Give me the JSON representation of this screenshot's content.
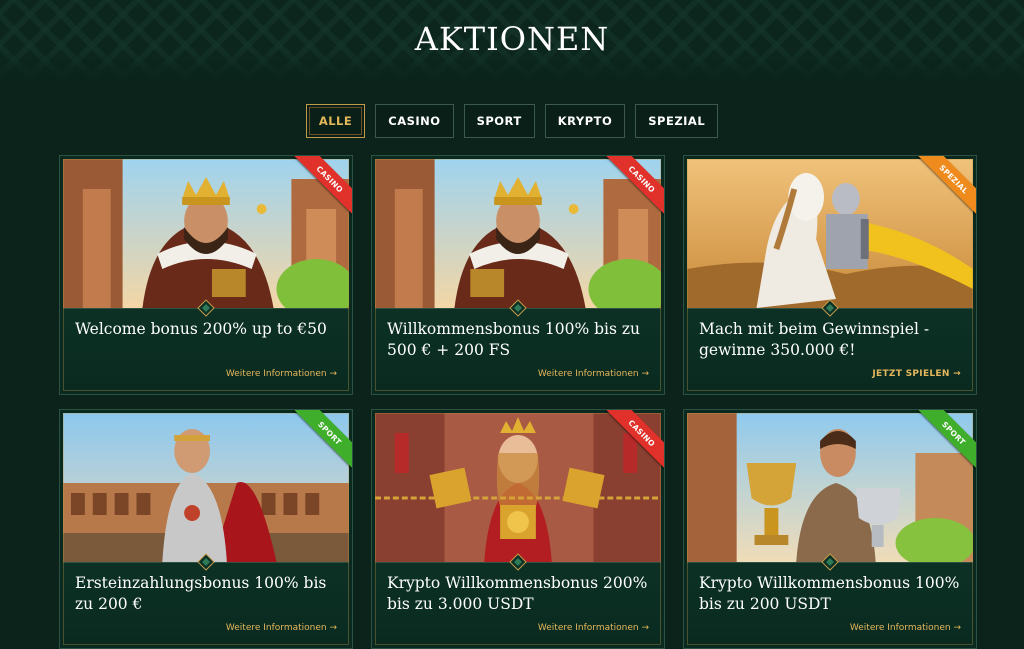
{
  "page": {
    "title": "AKTIONEN"
  },
  "filters": [
    {
      "label": "ALLE",
      "active": true
    },
    {
      "label": "CASINO",
      "active": false
    },
    {
      "label": "SPORT",
      "active": false
    },
    {
      "label": "KRYPTO",
      "active": false
    },
    {
      "label": "SPEZIAL",
      "active": false
    }
  ],
  "cards": [
    {
      "ribbon": "CASINO",
      "title": "Welcome bonus 200% up to €50",
      "link": "Weitere Informationen →"
    },
    {
      "ribbon": "CASINO",
      "title": "Willkommensbonus 100% bis zu 500 € + 200 FS",
      "link": "Weitere Informationen →"
    },
    {
      "ribbon": "SPEZIAL",
      "title": "Mach mit beim Gewinnspiel - gewinne 350.000 €!",
      "link": "JETZT SPIELEN →"
    },
    {
      "ribbon": "SPORT",
      "title": "Ersteinzahlungsbonus 100% bis zu 200 €",
      "link": "Weitere Informationen →"
    },
    {
      "ribbon": "CASINO",
      "title": "Krypto Willkommensbonus 200% bis zu 3.000 USDT",
      "link": "Weitere Informationen →"
    },
    {
      "ribbon": "SPORT",
      "title": "Krypto Willkommensbonus 100% bis zu 200 USDT",
      "link": "Weitere Informationen →"
    }
  ],
  "colors": {
    "background": "#0b231b",
    "accent_gold": "#e5b75c",
    "ribbon_casino": "#e0312a",
    "ribbon_sport": "#3fae2a",
    "ribbon_spezial": "#ef8a1c"
  },
  "icons": [
    "knot-pattern",
    "gem-divider-icon",
    "arrow-right-icon"
  ]
}
